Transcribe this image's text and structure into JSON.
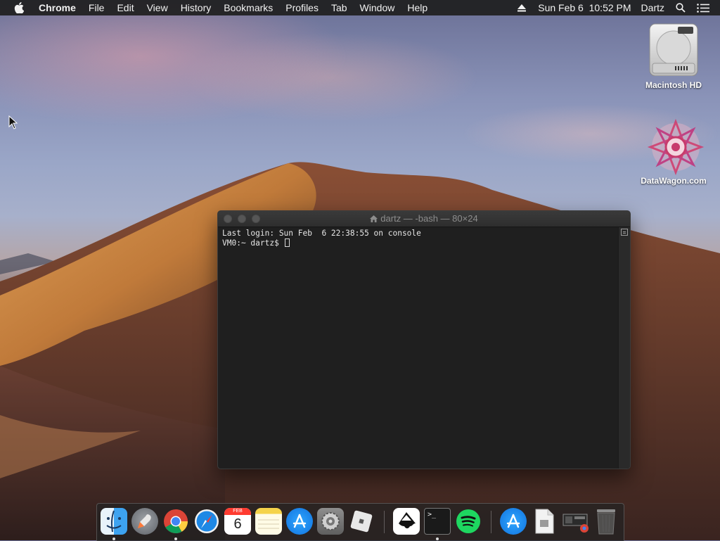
{
  "menubar": {
    "app_name": "Chrome",
    "menus": [
      "File",
      "Edit",
      "View",
      "History",
      "Bookmarks",
      "Profiles",
      "Tab",
      "Window",
      "Help"
    ],
    "clock": "Sun Feb 6  10:52 PM",
    "user": "Dartz"
  },
  "desktop": {
    "icons": [
      {
        "label": "Macintosh HD",
        "icon": "hard-drive-icon"
      },
      {
        "label": "DataWagon.com",
        "icon": "datawagon-logo-icon"
      }
    ]
  },
  "terminal": {
    "title": "dartz — -bash — 80×24",
    "lines": [
      "Last login: Sun Feb  6 22:38:55 on console",
      "VM0:~ dartz$ "
    ]
  },
  "dock": {
    "apps": [
      {
        "name": "Finder",
        "icon": "finder-icon",
        "running": true
      },
      {
        "name": "Launchpad",
        "icon": "launchpad-icon",
        "running": false
      },
      {
        "name": "Google Chrome",
        "icon": "chrome-icon",
        "running": true
      },
      {
        "name": "Safari",
        "icon": "safari-icon",
        "running": false
      },
      {
        "name": "Calendar",
        "icon": "calendar-icon",
        "running": false,
        "month": "FEB",
        "day": "6"
      },
      {
        "name": "Notes",
        "icon": "notes-icon",
        "running": false
      },
      {
        "name": "App Store",
        "icon": "app-store-icon",
        "running": false
      },
      {
        "name": "System Preferences",
        "icon": "system-preferences-icon",
        "running": false
      },
      {
        "name": "Roblox",
        "icon": "roblox-icon",
        "running": false
      },
      {
        "name": "Inkscape",
        "icon": "inkscape-icon",
        "running": false
      },
      {
        "name": "Terminal",
        "icon": "terminal-icon",
        "running": true
      },
      {
        "name": "Spotify",
        "icon": "spotify-icon",
        "running": false
      },
      {
        "name": "Applications",
        "icon": "applications-folder-icon",
        "running": false
      },
      {
        "name": "Document",
        "icon": "document-icon",
        "running": false
      },
      {
        "name": "Chrome Apps",
        "icon": "chrome-apps-icon",
        "running": false
      },
      {
        "name": "Trash",
        "icon": "trash-icon",
        "running": false
      }
    ]
  }
}
